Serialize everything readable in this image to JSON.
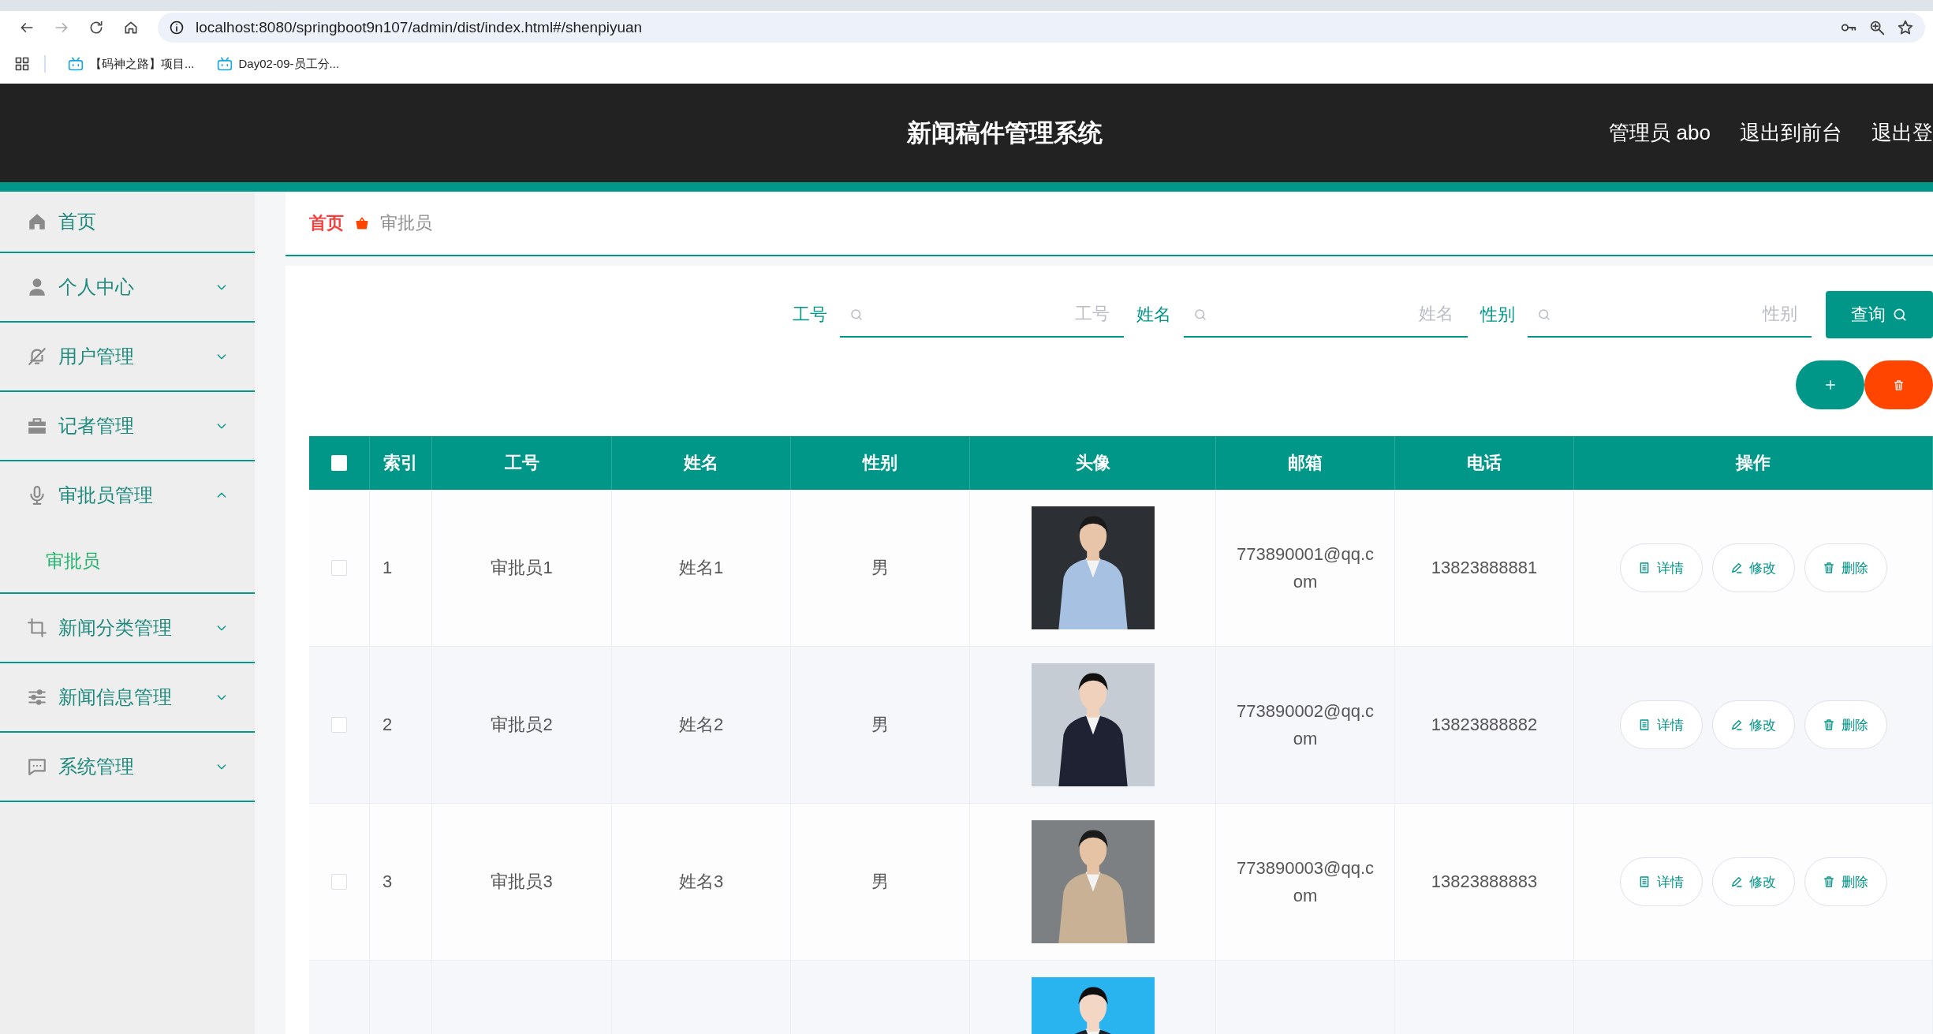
{
  "browser": {
    "url": "localhost:8080/springboot9n107/admin/dist/index.html#/shenpiyuan",
    "bookmarks": [
      "【码神之路】项目...",
      "Day02-09-员工分..."
    ]
  },
  "header": {
    "title": "新闻稿件管理系统",
    "links": [
      "管理员 abo",
      "退出到前台",
      "退出登"
    ]
  },
  "sidebar": {
    "items": [
      {
        "kind": "link",
        "label": "首页"
      },
      {
        "kind": "menu",
        "label": "个人中心",
        "expanded": false
      },
      {
        "kind": "menu",
        "label": "用户管理",
        "expanded": false
      },
      {
        "kind": "menu",
        "label": "记者管理",
        "expanded": false
      },
      {
        "kind": "menu",
        "label": "审批员管理",
        "expanded": true,
        "children": [
          {
            "label": "审批员",
            "selected": true
          }
        ]
      },
      {
        "kind": "menu",
        "label": "新闻分类管理",
        "expanded": false
      },
      {
        "kind": "menu",
        "label": "新闻信息管理",
        "expanded": false
      },
      {
        "kind": "menu",
        "label": "系统管理",
        "expanded": false
      }
    ]
  },
  "breadcrumb": [
    "首页",
    "审批员"
  ],
  "search": {
    "fields": [
      {
        "label": "工号",
        "placeholder": "工号"
      },
      {
        "label": "姓名",
        "placeholder": "姓名"
      },
      {
        "label": "性别",
        "placeholder": "性别"
      }
    ],
    "button": "查询"
  },
  "table": {
    "select_all": false,
    "columns": [
      "索引",
      "工号",
      "姓名",
      "性别",
      "头像",
      "邮箱",
      "电话",
      "操作"
    ],
    "rows": [
      {
        "checked": false,
        "index": "1",
        "id": "审批员1",
        "name": "姓名1",
        "gender": "男",
        "photo": {
          "kind": "picture"
        },
        "email": "773890001@qq.com",
        "phone": "13823888881",
        "actions": [
          "详情",
          "修改",
          "删除"
        ]
      },
      {
        "checked": false,
        "index": "2",
        "id": "审批员2",
        "name": "姓名2",
        "gender": "男",
        "photo": {
          "kind": "picture"
        },
        "email": "773890002@qq.com",
        "phone": "13823888882",
        "actions": [
          "详情",
          "修改",
          "删除"
        ]
      },
      {
        "checked": false,
        "index": "3",
        "id": "审批员3",
        "name": "姓名3",
        "gender": "男",
        "photo": {
          "kind": "picture"
        },
        "email": "773890003@qq.com",
        "phone": "13823888883",
        "actions": [
          "详情",
          "修改",
          "删除"
        ]
      },
      {
        "photo": {
          "kind": "picture"
        }
      }
    ]
  }
}
